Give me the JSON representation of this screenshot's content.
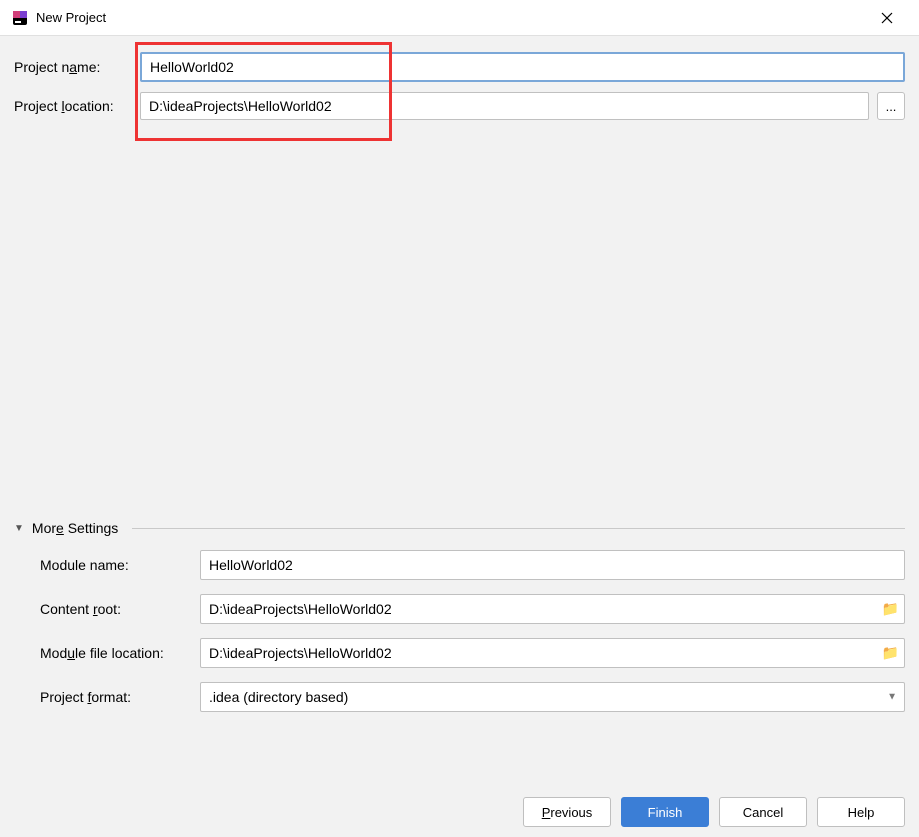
{
  "window": {
    "title": "New Project"
  },
  "fields": {
    "project_name_label": "Project name:",
    "project_name_value": "HelloWorld02",
    "project_location_label": "Project location:",
    "project_location_value": "D:\\ideaProjects\\HelloWorld02",
    "browse_label": "..."
  },
  "more_settings": {
    "header": "More Settings",
    "module_name_label": "Module name:",
    "module_name_value": "HelloWorld02",
    "content_root_label": "Content root:",
    "content_root_value": "D:\\ideaProjects\\HelloWorld02",
    "module_file_location_label": "Module file location:",
    "module_file_location_value": "D:\\ideaProjects\\HelloWorld02",
    "project_format_label": "Project format:",
    "project_format_value": ".idea (directory based)"
  },
  "buttons": {
    "previous": "Previous",
    "finish": "Finish",
    "cancel": "Cancel",
    "help": "Help"
  }
}
